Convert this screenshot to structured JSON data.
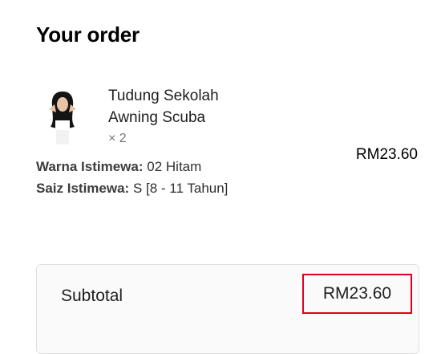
{
  "order": {
    "title": "Your order",
    "item": {
      "name": "Tudung Sekolah Awning Scuba",
      "quantity": "× 2",
      "price": "RM23.60",
      "color_label": "Warna Istimewa:",
      "color_value": "02 Hitam",
      "size_label": "Saiz Istimewa:",
      "size_value": "S [8 - 11 Tahun]",
      "thumbnail_icon": "product-thumbnail-icon"
    },
    "subtotal": {
      "label": "Subtotal",
      "value": "RM23.60"
    }
  },
  "colors": {
    "highlight_border": "#e0001b",
    "totals_border": "#e0e0e0"
  }
}
